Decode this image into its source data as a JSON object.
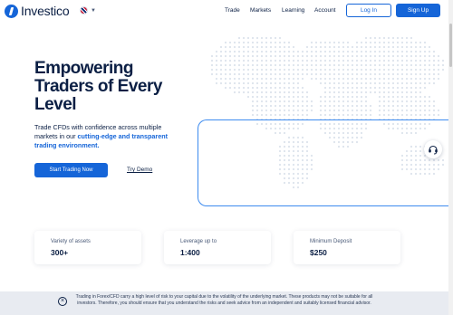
{
  "brand": {
    "name": "Investico"
  },
  "language": {
    "flag_icon": "uk-flag-icon",
    "caret_icon": "chevron-down-icon"
  },
  "nav": {
    "items": [
      "Trade",
      "Markets",
      "Learning",
      "Account"
    ]
  },
  "auth": {
    "login_label": "Log In",
    "signup_label": "Sign Up"
  },
  "hero": {
    "title": "Empowering Traders of Every Level",
    "subtitle_plain": "Trade CFDs with confidence across multiple markets in our ",
    "subtitle_highlight": "cutting-edge and transparent trading environment.",
    "cta_label": "Start Trading Now",
    "demo_label": "Try Demo"
  },
  "support": {
    "icon": "headset-icon"
  },
  "stats": [
    {
      "label": "Variety of assets",
      "value": "300+"
    },
    {
      "label": "Leverage up to",
      "value": "1:400"
    },
    {
      "label": "Minimum Deposit",
      "value": "$250"
    }
  ],
  "risk_warning": {
    "close_icon": "close-icon",
    "text": "Trading in Forex/CFD carry a high level of risk to your capital due to the volatility of the underlying market. These products may not be suitable for all investors. Therefore, you should ensure that you understand the risks and seek advice from an independent and suitably licensed financial advisor."
  },
  "colors": {
    "accent": "#1565d8",
    "text": "#0b1f44",
    "map_dot": "#dde3ec",
    "risk_bg": "#e8ebf1"
  }
}
